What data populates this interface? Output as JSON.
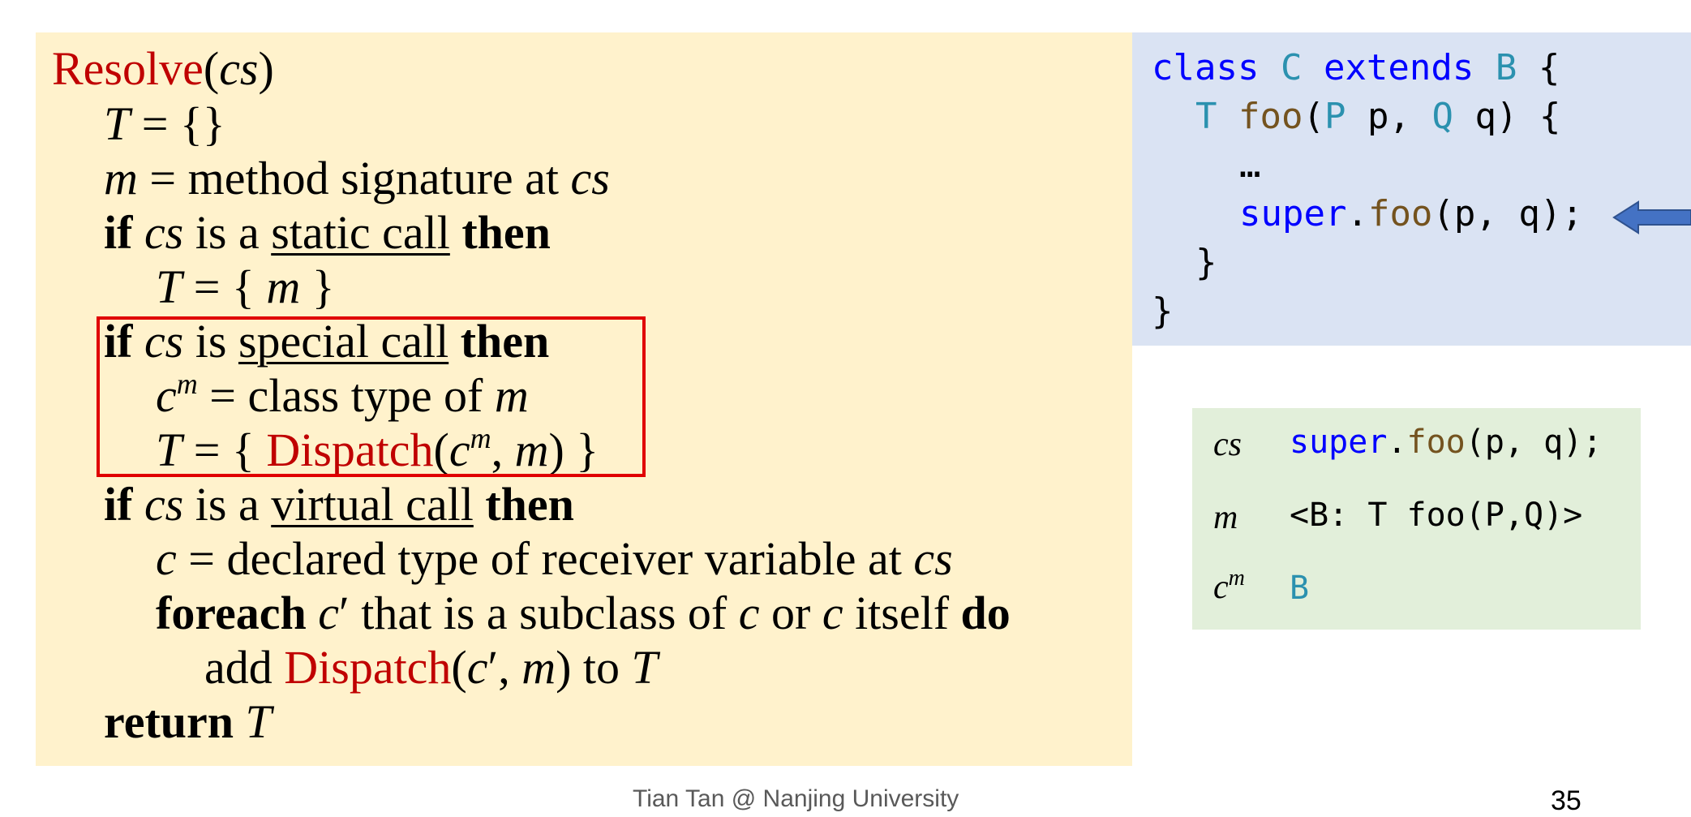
{
  "algorithm": {
    "title_func": "Resolve",
    "title_arg": "cs",
    "T": "T",
    "m": "m",
    "cs": "cs",
    "c": "c",
    "line_T_empty_rest": " = {}",
    "line_m_rest": " = method signature at ",
    "kw_if": "if",
    "kw_then": "then",
    "kw_foreach": "foreach",
    "kw_do": "do",
    "kw_return": "return",
    "is_a": " is a ",
    "is": " is ",
    "static_call": "static call",
    "special_call": "special call",
    "virtual_call": "virtual call",
    "set_open": " = { ",
    "set_close": " }",
    "cm_sup": "m",
    "class_type_of": " = class type of ",
    "dispatch": "Dispatch",
    "declared_type": " = declared type of receiver variable at ",
    "prime": "′",
    "subclass_text": " that is a subclass of ",
    "or_text": " or ",
    "itself_text": " itself  ",
    "add_text": "add ",
    "to_text": " to "
  },
  "code": {
    "kw_class": "class",
    "class_name": "C",
    "kw_extends": "extends",
    "base_name": "B",
    "brace_open": " {",
    "ret_type": "T",
    "method": "foo",
    "param1_type": "P",
    "param1": " p, ",
    "param2_type": "Q",
    "param2": " q) {",
    "ellipsis": "…",
    "kw_super": "super",
    "call_args": "(p, q);",
    "brace_close": "}"
  },
  "table": {
    "row_cs_label": "cs",
    "row_cs_kw": "super",
    "row_cs_method": "foo",
    "row_cs_args": "(p, q);",
    "row_m_label": "m",
    "row_m_value": "<B: T foo(P,Q)>",
    "row_cm_label": "c",
    "row_cm_sup": "m",
    "row_cm_value": "B"
  },
  "footer": {
    "credit": "Tian Tan @ Nanjing University",
    "page": "35"
  },
  "colors": {
    "algo_bg": "#fff2cc",
    "code_bg": "#dae3f3",
    "table_bg": "#e2efda",
    "highlight": "#e00000",
    "dispatch_red": "#c00000",
    "arrow": "#4472c4"
  }
}
